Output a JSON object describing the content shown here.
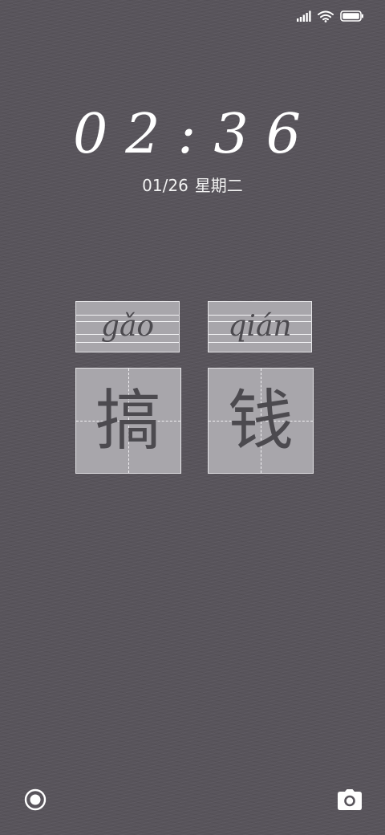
{
  "status_bar": {
    "icons": [
      "signal-icon",
      "wifi-icon",
      "battery-icon"
    ]
  },
  "lockscreen": {
    "time": "02:36",
    "date": "01/26",
    "weekday": "星期二"
  },
  "cards": [
    {
      "pinyin": "gǎo",
      "character": "搞"
    },
    {
      "pinyin": "qián",
      "character": "钱"
    }
  ],
  "shortcuts": {
    "left_icon": "circle-icon",
    "right_icon": "camera-icon"
  }
}
